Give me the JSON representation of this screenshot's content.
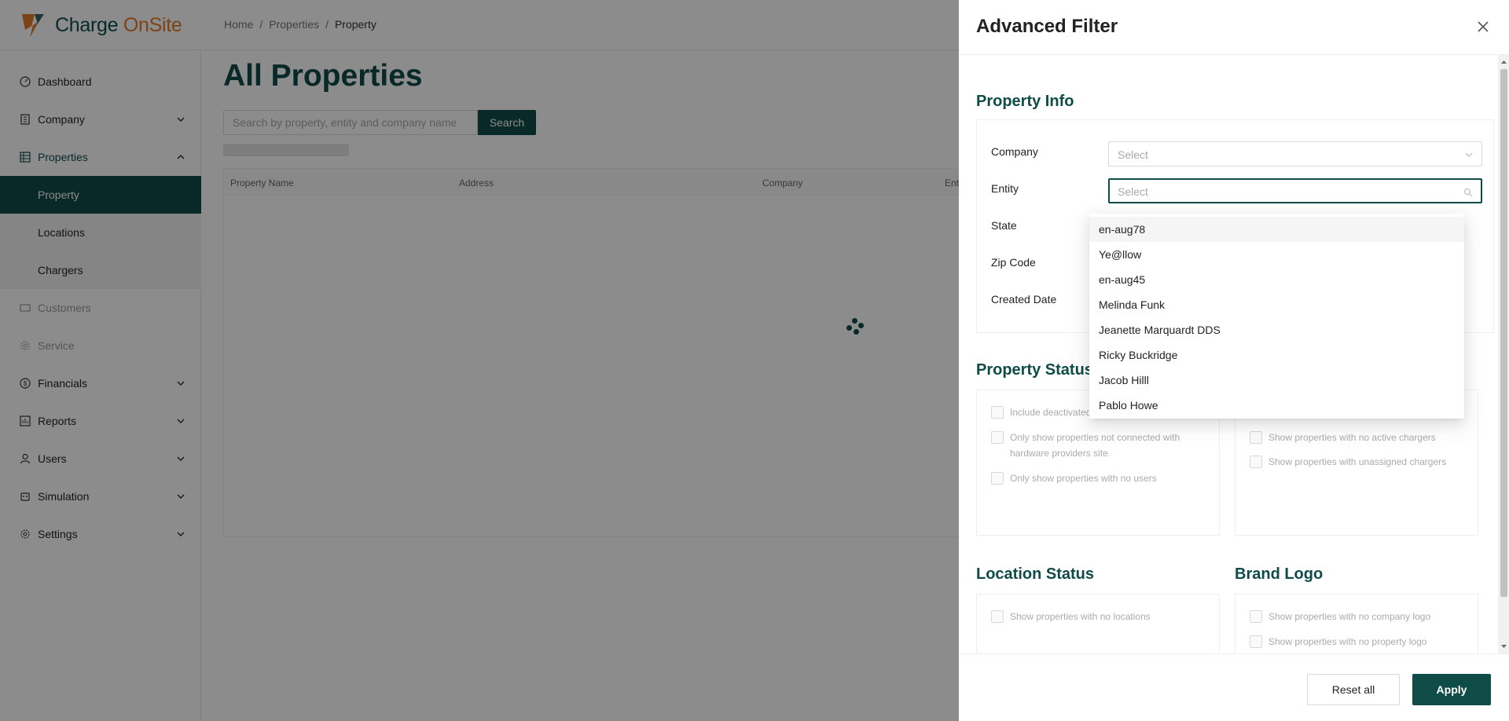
{
  "app": {
    "logo_part1": "Charge ",
    "logo_part2": "OnSite"
  },
  "breadcrumb": {
    "items": [
      "Home",
      "Properties",
      "Property"
    ],
    "separator": "/"
  },
  "sidebar": {
    "items": [
      {
        "label": "Dashboard",
        "icon": "dashboard-icon"
      },
      {
        "label": "Company",
        "icon": "building-icon",
        "expandable": true
      },
      {
        "label": "Properties",
        "icon": "grid-icon",
        "expanded": true
      },
      {
        "label": "Property",
        "active": true
      },
      {
        "label": "Locations"
      },
      {
        "label": "Chargers"
      },
      {
        "label": "Customers",
        "icon": "id-card-icon",
        "disabled": true
      },
      {
        "label": "Service",
        "icon": "gear-icon",
        "disabled": true
      },
      {
        "label": "Financials",
        "icon": "dollar-icon",
        "expandable": true
      },
      {
        "label": "Reports",
        "icon": "report-icon",
        "expandable": true
      },
      {
        "label": "Users",
        "icon": "user-icon",
        "expandable": true
      },
      {
        "label": "Simulation",
        "icon": "robot-icon",
        "expandable": true
      },
      {
        "label": "Settings",
        "icon": "gear-icon",
        "expandable": true
      }
    ]
  },
  "main": {
    "title": "All Properties",
    "search_placeholder": "Search by property, entity and company name",
    "search_button": "Search",
    "columns": [
      "Property Name",
      "Address",
      "Company",
      "Ent"
    ]
  },
  "drawer": {
    "title": "Advanced Filter",
    "property_info": {
      "title": "Property Info",
      "fields": [
        {
          "label": "Company",
          "placeholder": "Select"
        },
        {
          "label": "Entity",
          "placeholder": "Select"
        },
        {
          "label": "State"
        },
        {
          "label": "Zip Code"
        },
        {
          "label": "Created Date"
        }
      ]
    },
    "entity_options": [
      "en-aug78",
      "Ye@llow",
      "en-aug45",
      "Melinda Funk",
      "Jeanette Marquardt DDS",
      "Ricky Buckridge",
      "Jacob Hilll",
      "Pablo Howe"
    ],
    "property_status": {
      "title": "Property Status",
      "left": [
        "Include deactivated",
        "Only show properties not connected with hardware providers site",
        "Only show properties with no users"
      ],
      "right": [
        "Show properties with no active chargers",
        "Show properties with unassigned chargers"
      ]
    },
    "location_status": {
      "title": "Location Status",
      "items": [
        "Show properties with no locations"
      ]
    },
    "brand_logo": {
      "title": "Brand Logo",
      "items": [
        "Show properties with no company logo",
        "Show properties with no property logo"
      ]
    },
    "reset_label": "Reset all",
    "apply_label": "Apply"
  },
  "colors": {
    "brand": "#0f4b47",
    "accent": "#e07b2a"
  }
}
